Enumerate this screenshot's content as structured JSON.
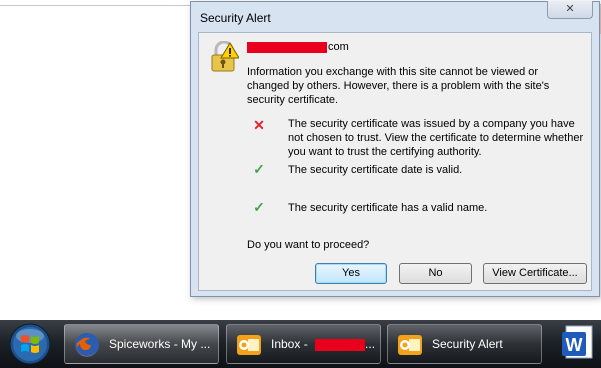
{
  "dialog": {
    "title": "Security Alert",
    "close_symbol": "✕",
    "site_suffix": "com",
    "info_text": "Information you exchange with this site cannot be viewed or changed by others. However, there is a problem with the site's security certificate.",
    "items": [
      {
        "status": "error",
        "icon": "red-x-icon",
        "text": "The security certificate was issued by a company you have not chosen to trust. View the certificate to determine whether you want to trust the certifying authority."
      },
      {
        "status": "ok",
        "icon": "green-check-icon",
        "text": "The security certificate date is valid."
      },
      {
        "status": "ok",
        "icon": "green-check-icon",
        "text": "The security certificate has a valid name."
      }
    ],
    "question": "Do you want to proceed?",
    "buttons": {
      "yes": "Yes",
      "no": "No",
      "view_certificate": "View Certificate..."
    }
  },
  "taskbar": {
    "tasks": [
      {
        "label": "Spiceworks - My ...",
        "icon": "firefox-icon"
      },
      {
        "label": "Inbox - ",
        "label_suffix": "...",
        "icon": "outlook-icon"
      },
      {
        "label": "Security Alert",
        "icon": "outlook-icon"
      }
    ],
    "pinned": [
      {
        "icon": "word-icon"
      }
    ]
  },
  "colors": {
    "error": "#e0262b",
    "ok": "#3ea64a",
    "redaction": "#e8001c",
    "dialog_frame": "#d7e3f1"
  }
}
